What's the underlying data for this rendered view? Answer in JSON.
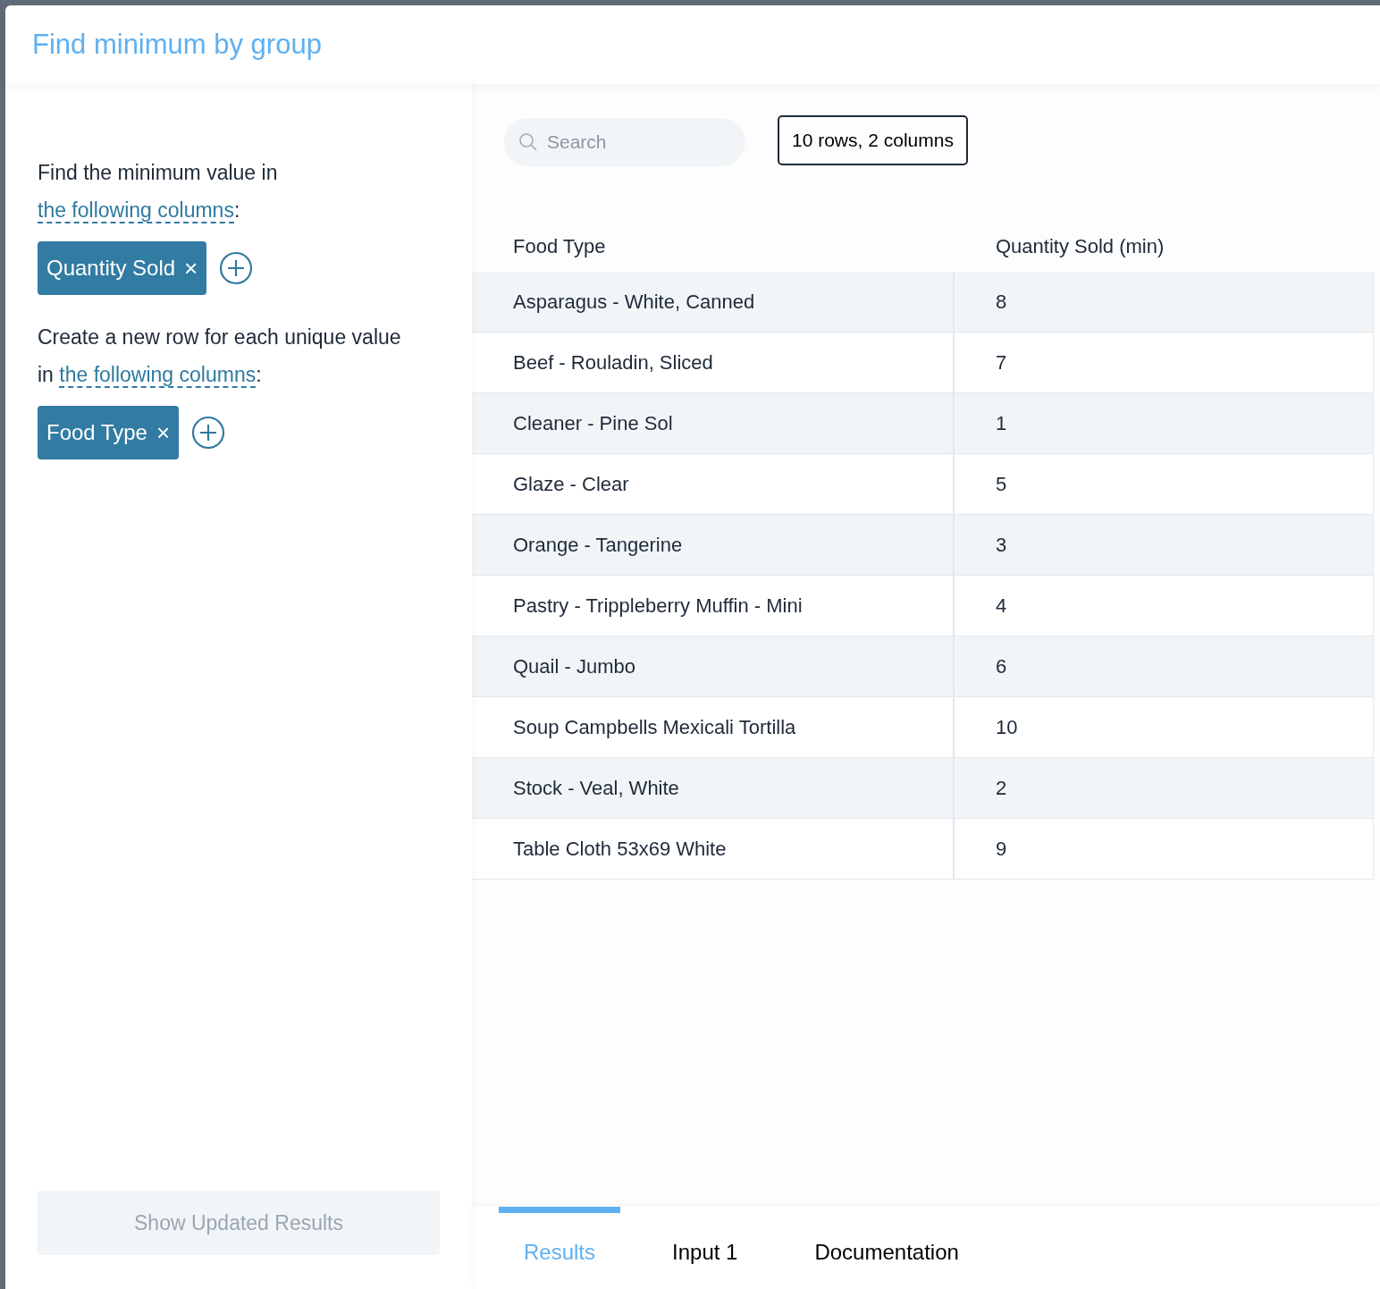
{
  "title": "Find minimum by group",
  "sections": [
    {
      "text": "Find the minimum value in ",
      "link": "the following columns",
      "suffix": ":",
      "chips": [
        {
          "label": "Quantity Sold",
          "remove": "×"
        }
      ]
    },
    {
      "text": "Create a new row for each unique value in ",
      "link": "the following columns",
      "suffix": ":",
      "chips": [
        {
          "label": "Food Type",
          "remove": "×"
        }
      ]
    }
  ],
  "apply_button": {
    "label": "Show Updated Results",
    "disabled": true
  },
  "search": {
    "placeholder": "Search"
  },
  "summary": "10 rows, 2 columns",
  "table": {
    "columns": [
      "Food Type",
      "Quantity Sold (min)"
    ],
    "rows": [
      [
        "Asparagus - White, Canned",
        "8"
      ],
      [
        "Beef - Rouladin, Sliced",
        "7"
      ],
      [
        "Cleaner - Pine Sol",
        "1"
      ],
      [
        "Glaze - Clear",
        "5"
      ],
      [
        "Orange - Tangerine",
        "3"
      ],
      [
        "Pastry - Trippleberry Muffin - Mini",
        "4"
      ],
      [
        "Quail - Jumbo",
        "6"
      ],
      [
        "Soup Campbells Mexicali Tortilla",
        "10"
      ],
      [
        "Stock - Veal, White",
        "2"
      ],
      [
        "Table Cloth 53x69 White",
        "9"
      ]
    ]
  },
  "tabs": [
    {
      "label": "Results",
      "selected": true
    },
    {
      "label": "Input 1",
      "selected": false
    },
    {
      "label": "Documentation",
      "selected": false
    }
  ]
}
